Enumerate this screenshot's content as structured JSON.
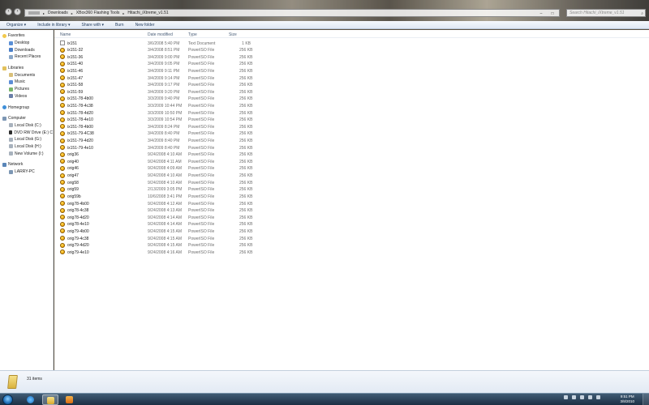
{
  "address": {
    "segments": [
      "Downloads",
      "XBox360 Flashing Tools",
      "Hitachi_iXtreme_v1.51"
    ]
  },
  "search": {
    "placeholder": "Search Hitachi_iXtreme_v1.51"
  },
  "toolbar": {
    "organize": "Organize ▾",
    "include": "Include in library ▾",
    "share": "Share with ▾",
    "burn": "Burn",
    "new_folder": "New folder"
  },
  "sidebar": {
    "favorites": {
      "label": "Favorites",
      "items": [
        "Desktop",
        "Downloads",
        "Recent Places"
      ]
    },
    "libraries": {
      "label": "Libraries",
      "items": [
        "Documents",
        "Music",
        "Pictures",
        "Videos"
      ]
    },
    "homegroup": {
      "label": "Homegroup"
    },
    "computer": {
      "label": "Computer",
      "items": [
        "Local Disk (C:)",
        "DVD RW Drive (E:) C",
        "Local Disk (G:)",
        "Local Disk (H:)",
        "New Volume (I:)"
      ]
    },
    "network": {
      "label": "Network",
      "items": [
        "LARRY-PC"
      ]
    }
  },
  "columns": {
    "name": "Name",
    "date": "Date modified",
    "type": "Type",
    "size": "Size"
  },
  "files": [
    {
      "name": "ix151",
      "date": "3/6/2008 5:40 PM",
      "type": "Text Document",
      "size": "1 KB",
      "icon": "text-file-icon"
    },
    {
      "name": "ix151-32",
      "date": "3/4/2008 8:51 PM",
      "type": "PowerISO File",
      "size": "256 KB",
      "icon": "poweriso-file-icon"
    },
    {
      "name": "ix151-36",
      "date": "3/4/2009 9:00 PM",
      "type": "PowerISO File",
      "size": "256 KB",
      "icon": "poweriso-file-icon"
    },
    {
      "name": "ix151-40",
      "date": "3/4/2009 9:05 PM",
      "type": "PowerISO File",
      "size": "256 KB",
      "icon": "poweriso-file-icon"
    },
    {
      "name": "ix151-46",
      "date": "3/4/2009 9:11 PM",
      "type": "PowerISO File",
      "size": "256 KB",
      "icon": "poweriso-file-icon"
    },
    {
      "name": "ix151-47",
      "date": "3/4/2009 9:14 PM",
      "type": "PowerISO File",
      "size": "256 KB",
      "icon": "poweriso-file-icon"
    },
    {
      "name": "ix151-58",
      "date": "3/4/2009 9:17 PM",
      "type": "PowerISO File",
      "size": "256 KB",
      "icon": "poweriso-file-icon"
    },
    {
      "name": "ix151-59",
      "date": "3/4/2009 9:20 PM",
      "type": "PowerISO File",
      "size": "256 KB",
      "icon": "poweriso-file-icon"
    },
    {
      "name": "ix151-78-4b00",
      "date": "3/3/2009 9:40 PM",
      "type": "PowerISO File",
      "size": "256 KB",
      "icon": "poweriso-file-icon"
    },
    {
      "name": "ix151-78-4c38",
      "date": "3/3/2009 10:44 PM",
      "type": "PowerISO File",
      "size": "256 KB",
      "icon": "poweriso-file-icon"
    },
    {
      "name": "ix151-78-4d20",
      "date": "3/3/2009 10:50 PM",
      "type": "PowerISO File",
      "size": "256 KB",
      "icon": "poweriso-file-icon"
    },
    {
      "name": "ix151-78-4e10",
      "date": "3/3/2009 10:54 PM",
      "type": "PowerISO File",
      "size": "256 KB",
      "icon": "poweriso-file-icon"
    },
    {
      "name": "ix151-78-4b00",
      "date": "3/4/2009 8:24 PM",
      "type": "PowerISO File",
      "size": "256 KB",
      "icon": "poweriso-file-icon"
    },
    {
      "name": "ix151-79-4C38",
      "date": "3/4/2009 8:40 PM",
      "type": "PowerISO File",
      "size": "256 KB",
      "icon": "poweriso-file-icon"
    },
    {
      "name": "ix151-79-4d20",
      "date": "3/4/2009 8:40 PM",
      "type": "PowerISO File",
      "size": "256 KB",
      "icon": "poweriso-file-icon"
    },
    {
      "name": "ix151-79-4e10",
      "date": "3/4/2009 8:40 PM",
      "type": "PowerISO File",
      "size": "256 KB",
      "icon": "poweriso-file-icon"
    },
    {
      "name": "orig36",
      "date": "9/24/2008 4:10 AM",
      "type": "PowerISO File",
      "size": "256 KB",
      "icon": "poweriso-file-icon"
    },
    {
      "name": "orig40",
      "date": "9/24/2008 4:11 AM",
      "type": "PowerISO File",
      "size": "256 KB",
      "icon": "poweriso-file-icon"
    },
    {
      "name": "orig46",
      "date": "9/24/2008 4:09 AM",
      "type": "PowerISO File",
      "size": "256 KB",
      "icon": "poweriso-file-icon"
    },
    {
      "name": "orig47",
      "date": "9/24/2008 4:10 AM",
      "type": "PowerISO File",
      "size": "256 KB",
      "icon": "poweriso-file-icon"
    },
    {
      "name": "orig58",
      "date": "9/24/2008 4:10 AM",
      "type": "PowerISO File",
      "size": "256 KB",
      "icon": "poweriso-file-icon"
    },
    {
      "name": "orig59",
      "date": "2/13/2009 3:05 PM",
      "type": "PowerISO File",
      "size": "256 KB",
      "icon": "poweriso-file-icon"
    },
    {
      "name": "orig59b",
      "date": "10/6/2008 3:41 PM",
      "type": "PowerISO File",
      "size": "256 KB",
      "icon": "poweriso-file-icon"
    },
    {
      "name": "orig78-4b00",
      "date": "9/24/2008 4:12 AM",
      "type": "PowerISO File",
      "size": "256 KB",
      "icon": "poweriso-file-icon"
    },
    {
      "name": "orig78-4c38",
      "date": "9/24/2008 4:13 AM",
      "type": "PowerISO File",
      "size": "256 KB",
      "icon": "poweriso-file-icon"
    },
    {
      "name": "orig78-4d20",
      "date": "9/24/2008 4:14 AM",
      "type": "PowerISO File",
      "size": "256 KB",
      "icon": "poweriso-file-icon"
    },
    {
      "name": "orig78-4e10",
      "date": "9/24/2008 4:14 AM",
      "type": "PowerISO File",
      "size": "256 KB",
      "icon": "poweriso-file-icon"
    },
    {
      "name": "orig79-4b00",
      "date": "9/24/2008 4:15 AM",
      "type": "PowerISO File",
      "size": "256 KB",
      "icon": "poweriso-file-icon"
    },
    {
      "name": "orig79-4c38",
      "date": "9/24/2008 4:15 AM",
      "type": "PowerISO File",
      "size": "256 KB",
      "icon": "poweriso-file-icon"
    },
    {
      "name": "orig79-4d20",
      "date": "9/24/2008 4:15 AM",
      "type": "PowerISO File",
      "size": "256 KB",
      "icon": "poweriso-file-icon"
    },
    {
      "name": "orig79-4e10",
      "date": "9/24/2008 4:16 AM",
      "type": "PowerISO File",
      "size": "256 KB",
      "icon": "poweriso-file-icon"
    }
  ],
  "status": {
    "count": "31 items"
  },
  "taskbar": {
    "time": "9:51 PM",
    "date": "3/8/2010"
  }
}
